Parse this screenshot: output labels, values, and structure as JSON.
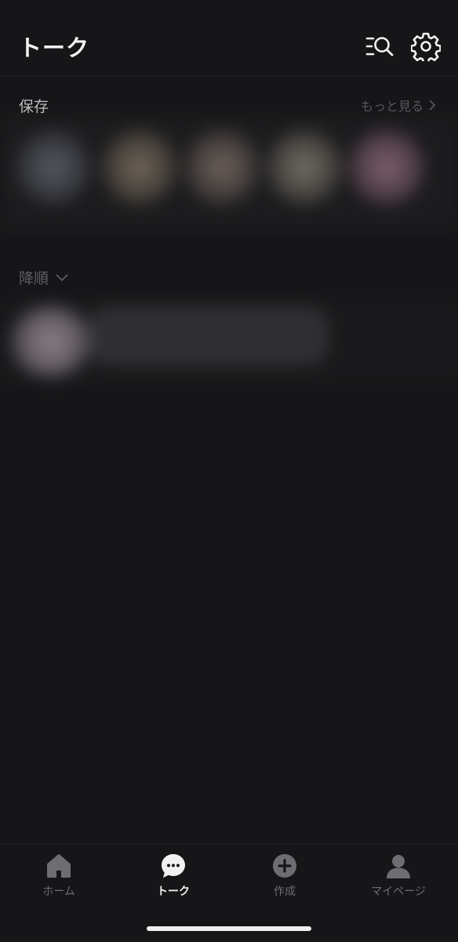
{
  "header": {
    "title": "トーク",
    "search_icon": "list-search-icon",
    "settings_icon": "gear-icon"
  },
  "saved": {
    "title": "保存",
    "see_more": "もっと見る"
  },
  "sort": {
    "label": "降順"
  },
  "tabbar": {
    "tabs": [
      {
        "label": "ホーム",
        "icon": "home-icon",
        "active": false
      },
      {
        "label": "トーク",
        "icon": "chat-bubble-icon",
        "active": true
      },
      {
        "label": "作成",
        "icon": "plus-circle-icon",
        "active": false
      },
      {
        "label": "マイページ",
        "icon": "person-icon",
        "active": false
      }
    ]
  },
  "colors": {
    "background": "#161618",
    "text_primary": "#f2f2f2",
    "text_muted": "#6d6d72"
  }
}
